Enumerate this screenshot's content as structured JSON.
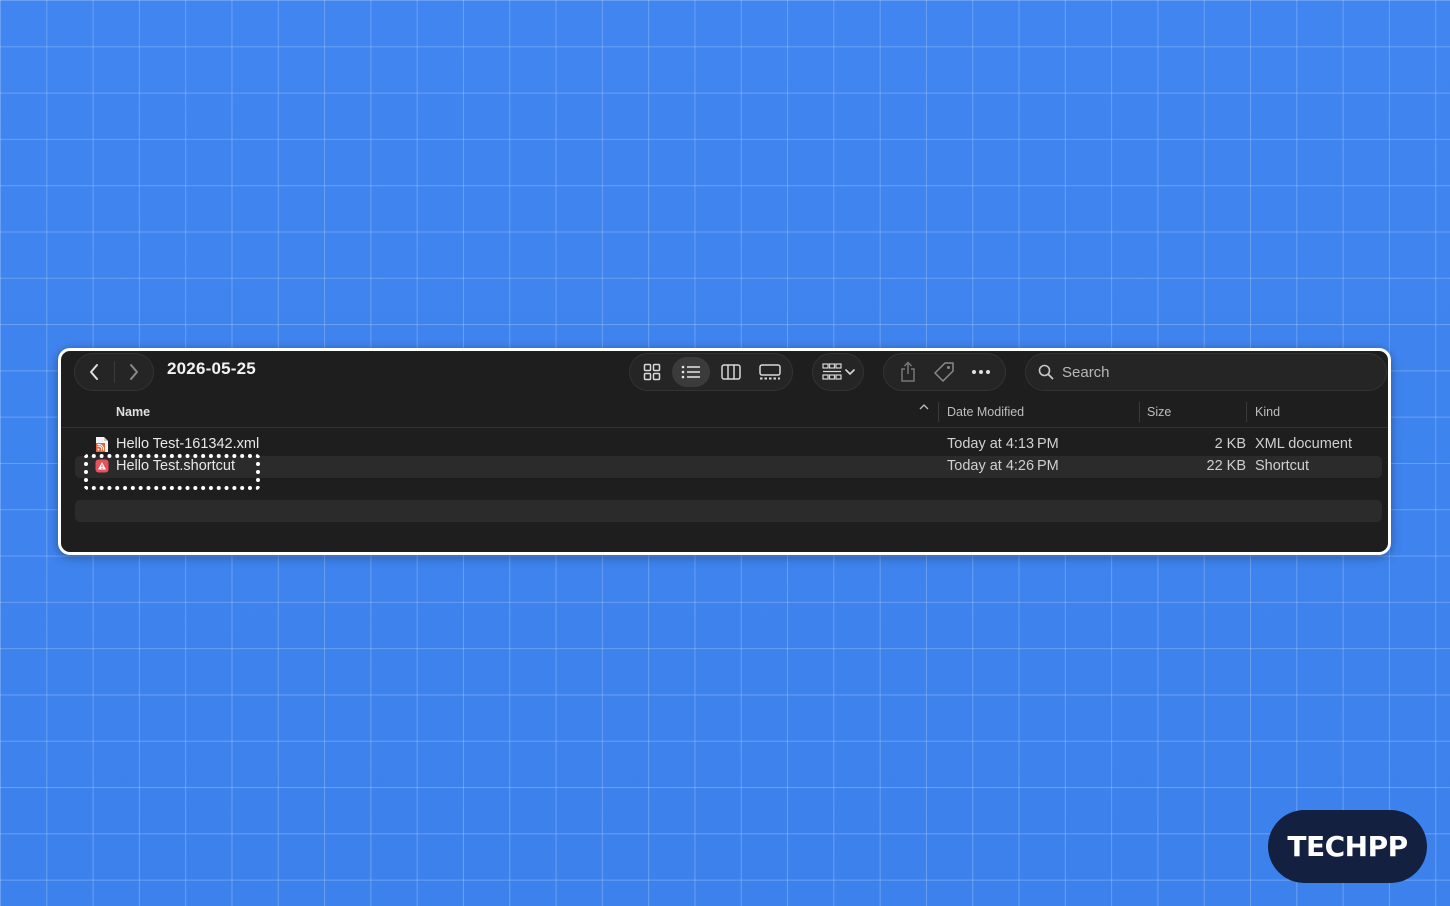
{
  "window": {
    "folder_title": "2026-05-25",
    "search_placeholder": "Search"
  },
  "columns": {
    "name": "Name",
    "date_modified": "Date Modified",
    "size": "Size",
    "kind": "Kind"
  },
  "files": [
    {
      "name": "Hello Test-161342.xml",
      "date": "Today at 4:13 PM",
      "size": "2 KB",
      "kind": "XML document",
      "icon": "xml-file-icon"
    },
    {
      "name": "Hello Test.shortcut",
      "date": "Today at 4:26 PM",
      "size": "22 KB",
      "kind": "Shortcut",
      "icon": "shortcut-file-icon"
    }
  ],
  "logo": {
    "text": "TECHPP"
  },
  "colors": {
    "background": "#3f84ee",
    "window": "#1e1e1e",
    "logo_bg": "#142040"
  }
}
